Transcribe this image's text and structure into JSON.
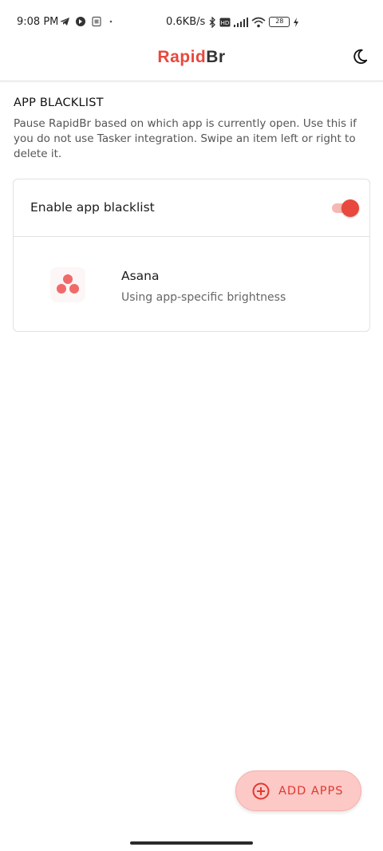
{
  "status_bar": {
    "time": "9:08 PM",
    "network_speed": "0.6KB/s",
    "battery_level": "28",
    "icons": [
      "telegram-icon",
      "signal-app-icon",
      "sim-icon",
      "dot-icon",
      "bluetooth-icon",
      "hd-icon",
      "cell-signal-icon",
      "wifi-icon",
      "battery-icon",
      "charging-icon"
    ]
  },
  "app_bar": {
    "title_accent": "Rapid",
    "title_rest": "Br",
    "theme_icon": "moon-icon"
  },
  "section": {
    "title": "APP BLACKLIST",
    "description": "Pause RapidBr based on which app is currently open. Use this if you do not use Tasker integration. Swipe an item left or right to delete it."
  },
  "blacklist_card": {
    "toggle_label": "Enable app blacklist",
    "toggle_on": true,
    "apps": [
      {
        "name": "Asana",
        "subtitle": "Using app-specific brightness",
        "icon": "asana-icon"
      }
    ]
  },
  "fab": {
    "label": "ADD APPS",
    "icon": "add-circle-icon"
  },
  "colors": {
    "accent": "#e8483d",
    "fab_bg": "#fcc9c6",
    "asana": "#f06a6a"
  }
}
